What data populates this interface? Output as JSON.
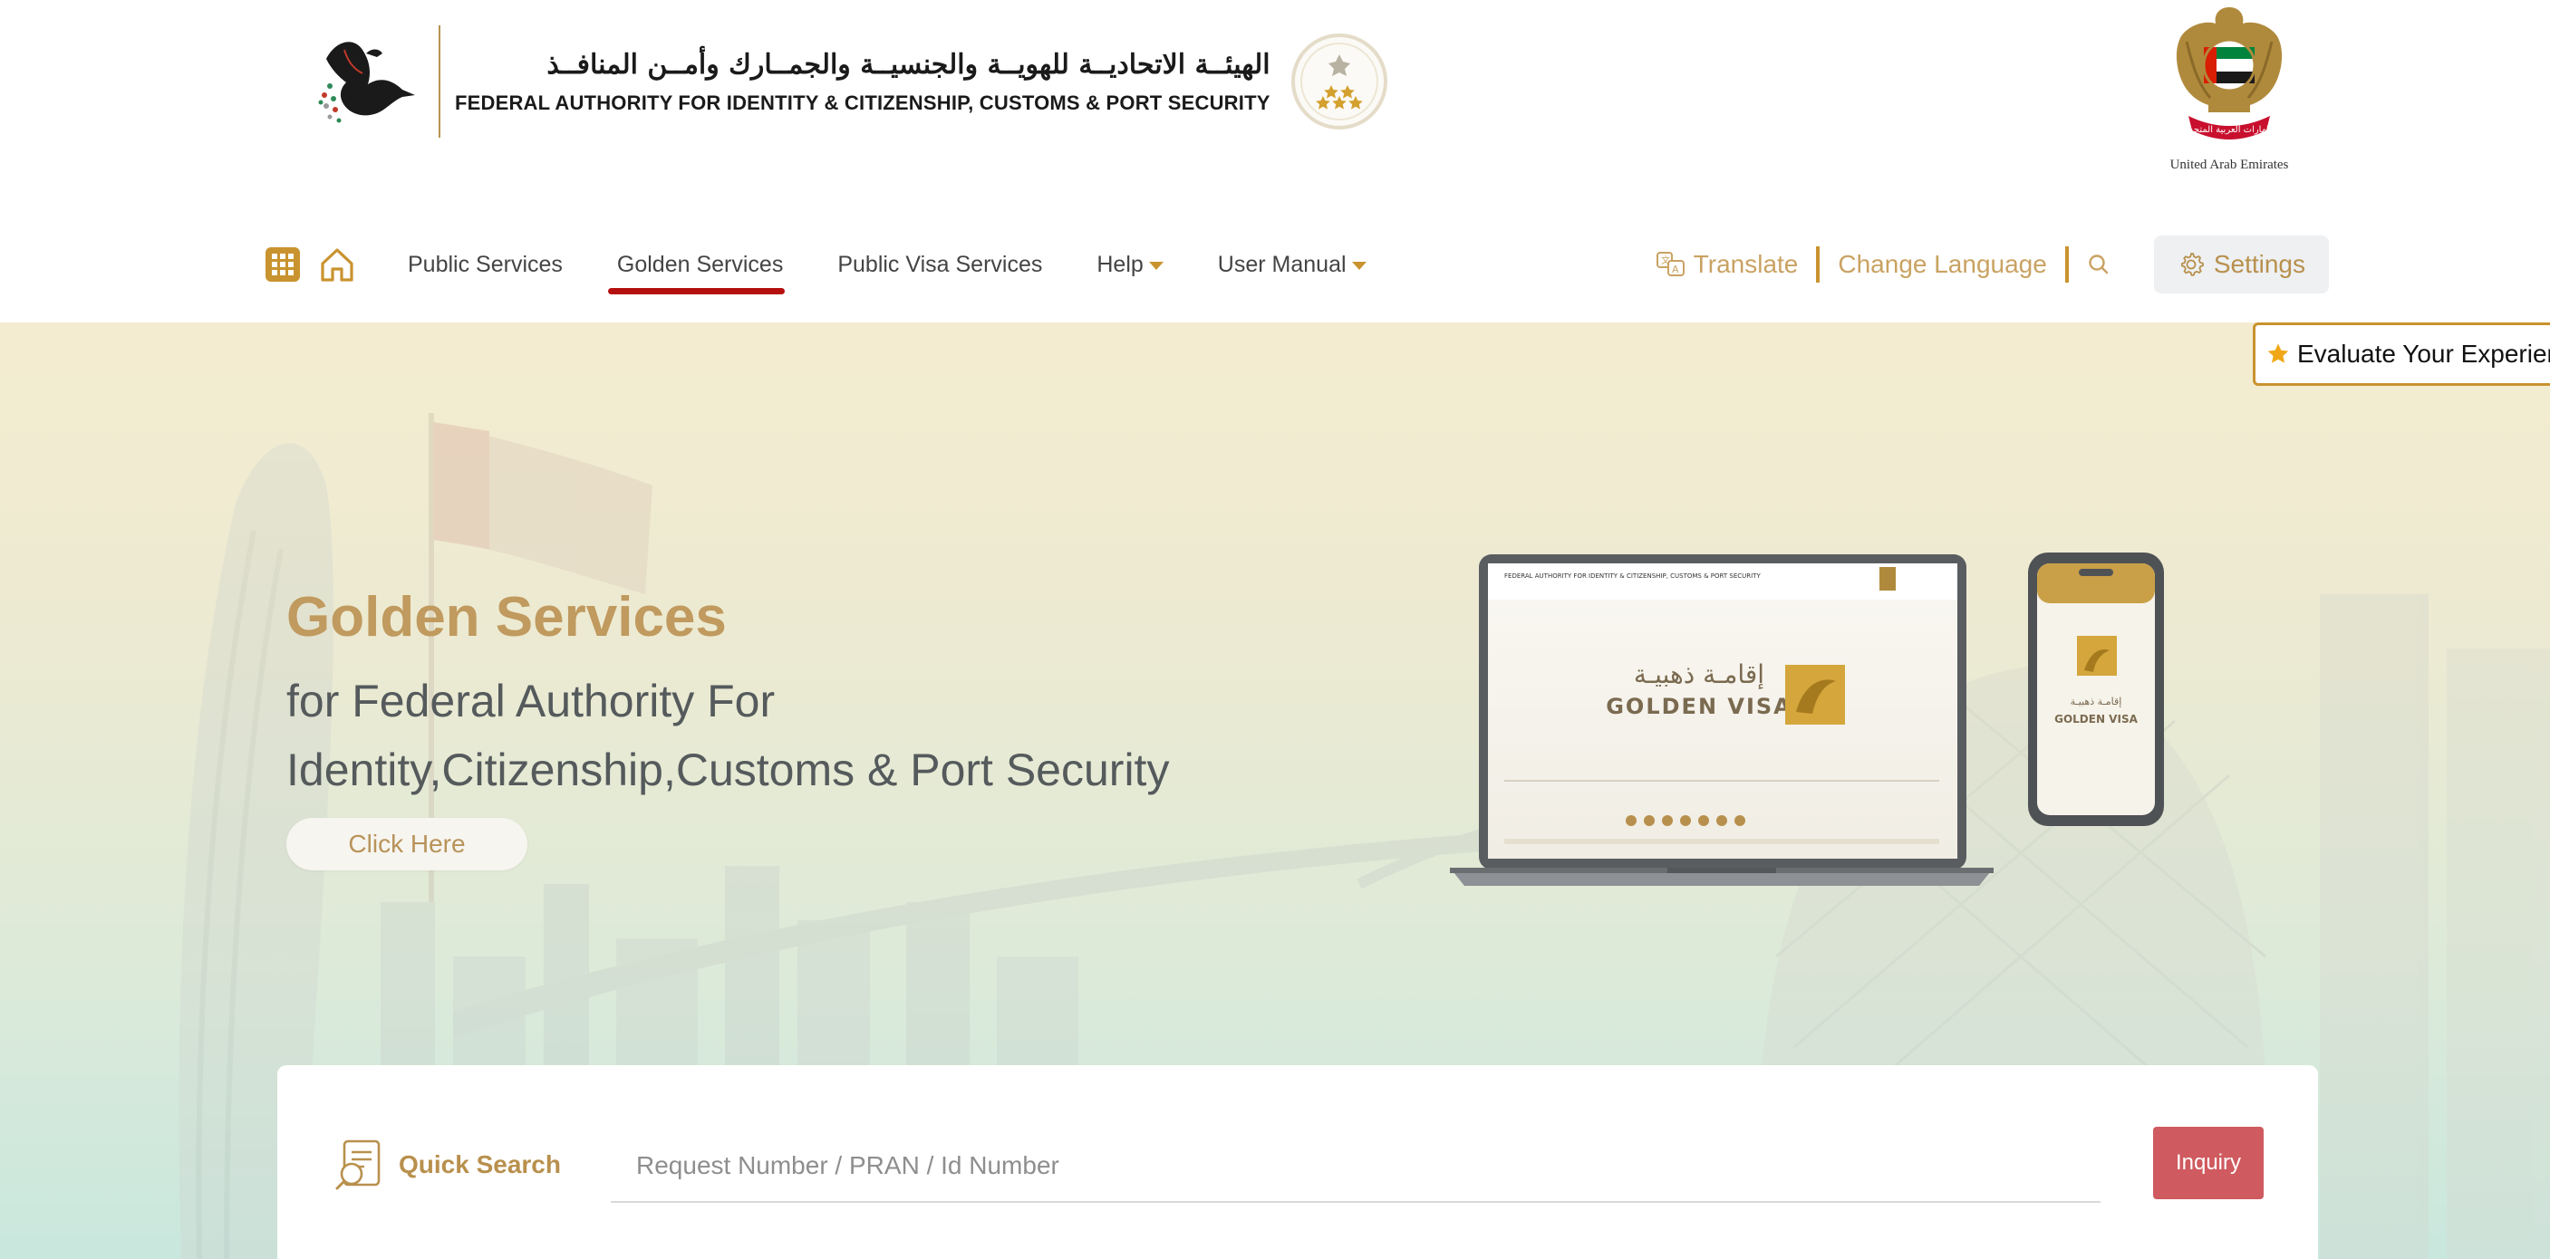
{
  "header": {
    "logo_ar": "الهيئــة الاتحاديــة للهويــة والجنسيــة والجمــارك وأمــن المنافــذ",
    "logo_en": "FEDERAL AUTHORITY FOR IDENTITY & CITIZENSHIP, CUSTOMS & PORT SECURITY",
    "emblem_caption": "United Arab Emirates",
    "emblem_ar": "الإمارات العربية المتحدة"
  },
  "nav": {
    "items": [
      {
        "label": "Public Services",
        "active": false
      },
      {
        "label": "Golden Services",
        "active": true
      },
      {
        "label": "Public Visa Services",
        "active": false
      },
      {
        "label": "Help",
        "dropdown": true
      },
      {
        "label": "User Manual",
        "dropdown": true
      }
    ],
    "translate": "Translate",
    "change_language": "Change Language",
    "settings": "Settings"
  },
  "hero": {
    "title": "Golden Services",
    "subtitle_line1": "for Federal Authority For",
    "subtitle_line2": "Identity,Citizenship,Customs & Port Security",
    "button": "Click Here",
    "screen_ar": "إقامـة ذهبيـة",
    "screen_en": "GOLDEN VISA"
  },
  "evaluate": {
    "label": "Evaluate Your Experience"
  },
  "quick_search": {
    "label": "Quick Search",
    "placeholder": "Request Number / PRAN / Id Number",
    "value": "",
    "button": "Inquiry"
  },
  "colors": {
    "gold": "#c9932f",
    "gold_text": "#c09a5e",
    "active_underline": "#b50f0f",
    "inquiry": "#cf5a5f"
  }
}
